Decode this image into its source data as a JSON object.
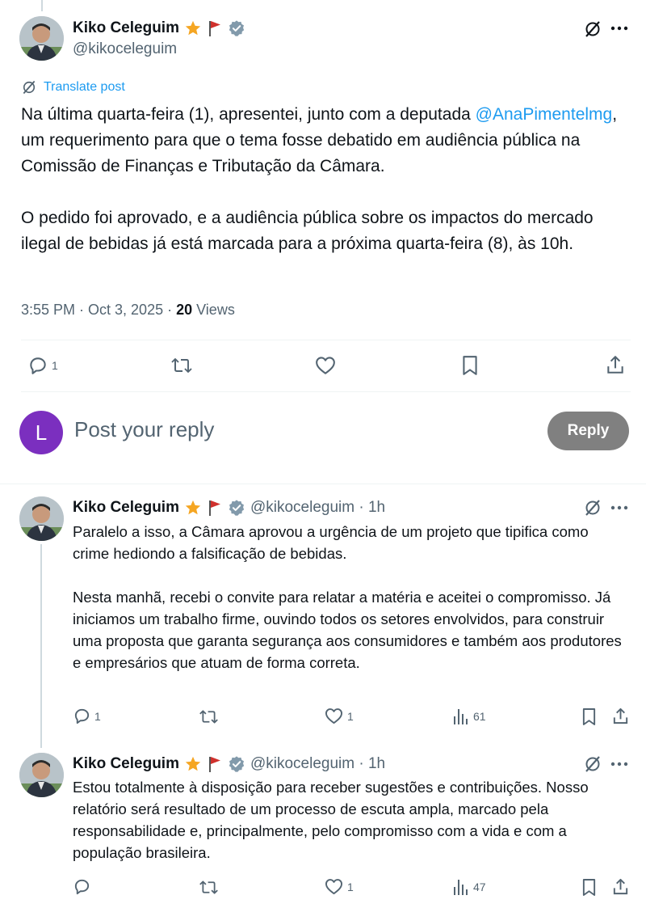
{
  "main_post": {
    "author": "Kiko Celeguim",
    "handle": "@kikoceleguim",
    "translate_label": "Translate post",
    "mention": "@AnaPimentelmg",
    "para1_before": "Na última quarta-feira (1), apresentei, junto com a deputada",
    "para1_after": ", um requerimento para que o tema fosse debatido em audiência pública na Comissão de Finanças e Tributação da Câmara.",
    "para2": "O pedido foi aprovado, e a audiência pública sobre os impactos do mercado ilegal de bebidas já está marcada para a próxima quarta-feira (8), às 10h.",
    "timestamp": "3:55 PM · Oct 3, 2025 · ",
    "views_count": "20",
    "views_label": " Views",
    "reply_count": "1"
  },
  "composer": {
    "avatar_letter": "L",
    "placeholder": "Post your reply",
    "reply_button": "Reply",
    "avatar_color": "#7b2fbf"
  },
  "replies": [
    {
      "author": "Kiko Celeguim",
      "handle_time": "@kikoceleguim · 1h",
      "text1": "Paralelo a isso, a Câmara aprovou a urgência de um projeto que tipifica como crime hediondo a falsificação de bebidas.",
      "text2": "Nesta manhã, recebi o convite para relatar a matéria e aceitei o compromisso. Já iniciamos um trabalho firme, ouvindo todos os setores envolvidos, para construir uma proposta que garanta segurança aos consumidores e também aos produtores e empresários que atuam de forma correta.",
      "reply_count": "1",
      "like_count": "1",
      "views_count": "61"
    },
    {
      "author": "Kiko Celeguim",
      "handle_time": "@kikoceleguim · 1h",
      "text1": "Estou totalmente à disposição para receber sugestões e contribuições. Nosso relatório será resultado de um processo de escuta ampla, marcado pela responsabilidade e, principalmente, pelo compromisso com a vida e com a população brasileira.",
      "reply_count": "",
      "like_count": "1",
      "views_count": "47"
    }
  ],
  "colors": {
    "link": "#1d9bf0",
    "verified": "#829aab",
    "star": "#f5a623",
    "flag": "#d0312d",
    "reply_button_bg": "#808080"
  }
}
